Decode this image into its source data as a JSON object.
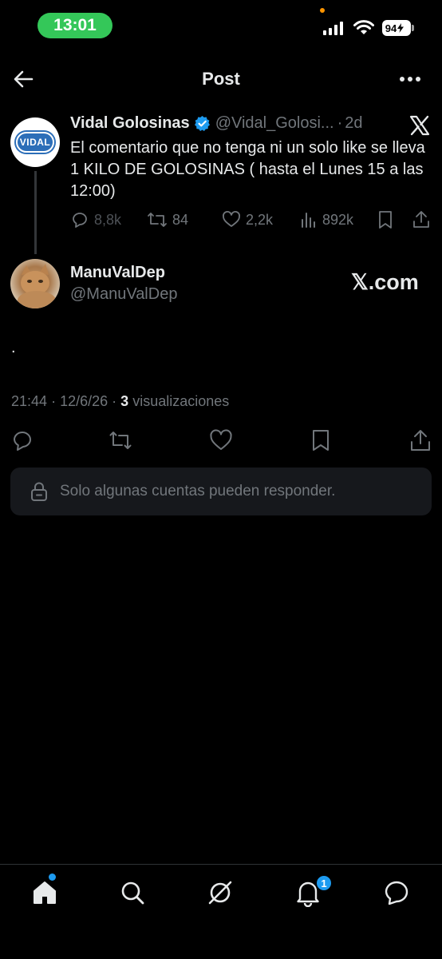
{
  "status_bar": {
    "time": "13:01",
    "battery": "94"
  },
  "header": {
    "title": "Post"
  },
  "quoted_post": {
    "author": "Vidal Golosinas",
    "handle": "@Vidal_Golosi...",
    "dot": "·",
    "age": "2d",
    "avatar_text": "VIDAL",
    "text": "El comentario que no tenga ni un solo like se lleva 1 KILO DE GOLOSINAS ( hasta el Lunes 15 a las 12:00)",
    "replies": "8,8k",
    "reposts": "84",
    "likes": "2,2k",
    "views": "892k"
  },
  "reply": {
    "author": "ManuValDep",
    "handle": "@ManuValDep",
    "body": ".",
    "watermark": "𝕏.com",
    "time": "21:44",
    "sep": "·",
    "date": "12/6/26",
    "views_count": "3",
    "views_label": "visualizaciones"
  },
  "restriction": {
    "text": "Solo algunas cuentas pueden responder."
  },
  "nav": {
    "notifications_badge": "1"
  },
  "colors": {
    "accent": "#1d9bf0",
    "background": "#000000",
    "muted": "#71767b",
    "status_green": "#34c759"
  }
}
